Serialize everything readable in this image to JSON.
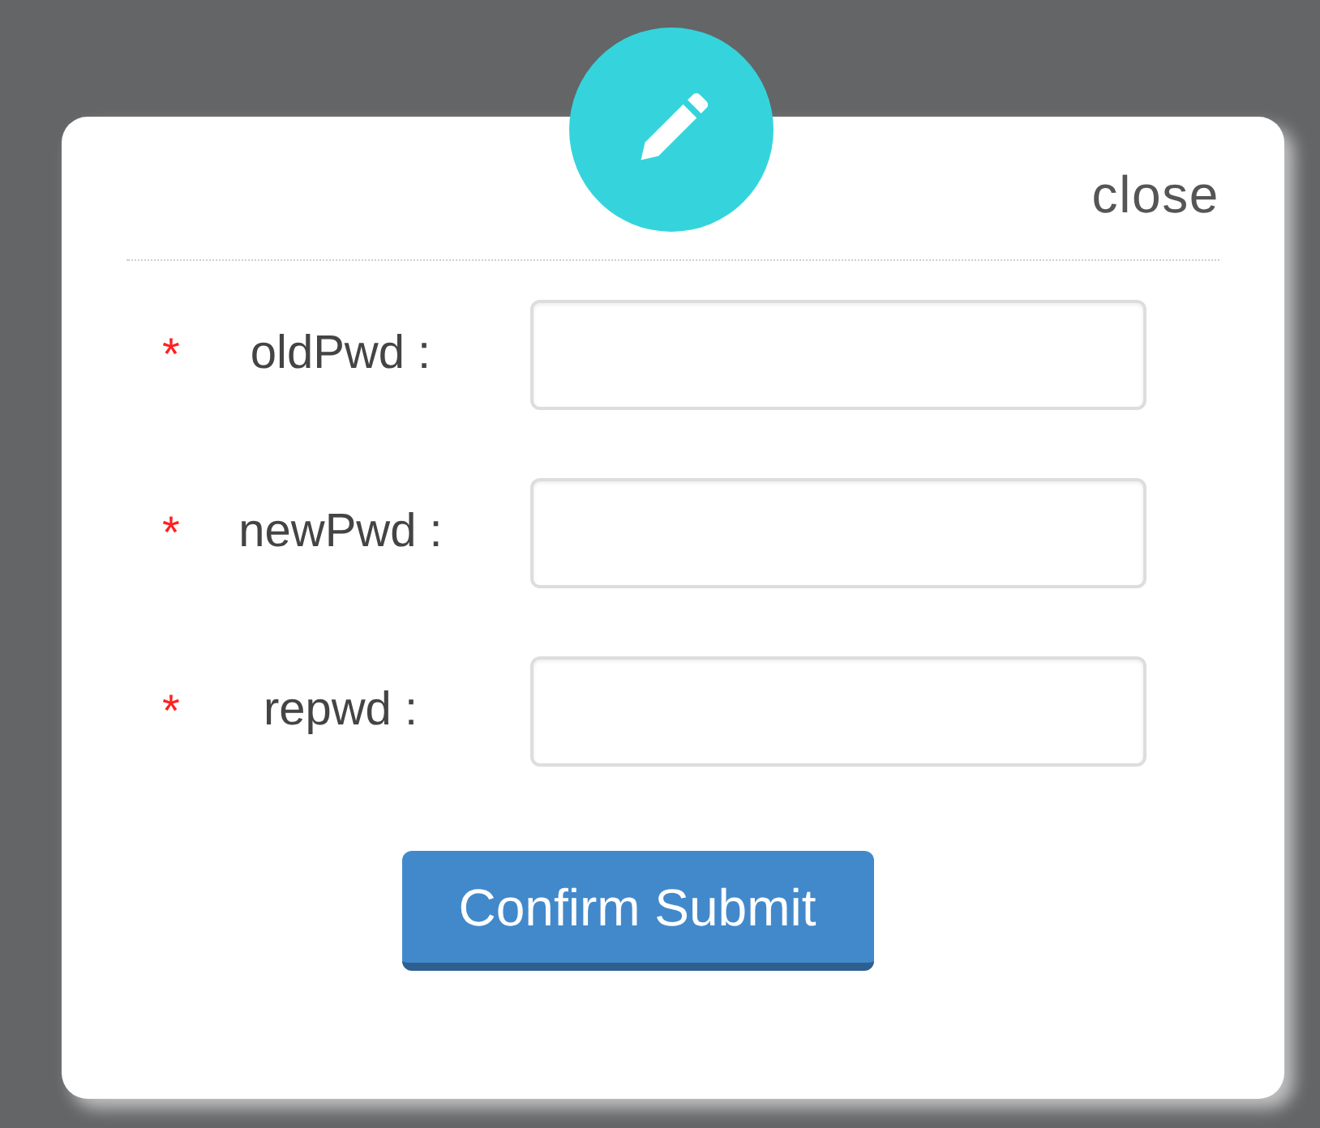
{
  "dialog": {
    "close": "close",
    "fields": [
      {
        "required": true,
        "mark": "*",
        "label": "oldPwd :"
      },
      {
        "required": true,
        "mark": "*",
        "label": "newPwd :"
      },
      {
        "required": true,
        "mark": "*",
        "label": "repwd :"
      }
    ],
    "submit": "Confirm Submit"
  }
}
